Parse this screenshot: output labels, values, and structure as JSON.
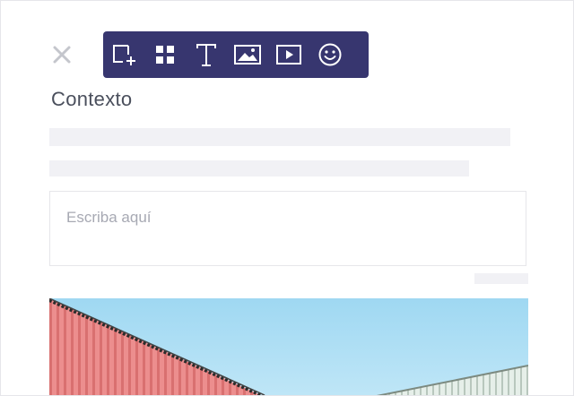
{
  "toolbar": {
    "tools": [
      {
        "icon": "add-frame-icon"
      },
      {
        "icon": "grid-icon"
      },
      {
        "icon": "text-icon"
      },
      {
        "icon": "image-icon"
      },
      {
        "icon": "video-icon"
      },
      {
        "icon": "emoji-icon"
      }
    ]
  },
  "close": {
    "icon": "close-icon"
  },
  "section": {
    "title": "Contexto"
  },
  "input": {
    "placeholder": "Escriba aquí"
  },
  "colors": {
    "toolbar_bg": "#37366f",
    "skeleton": "#f1f1f5",
    "sky": "#9fd8f2",
    "wall_red": "#ec8e8e"
  }
}
